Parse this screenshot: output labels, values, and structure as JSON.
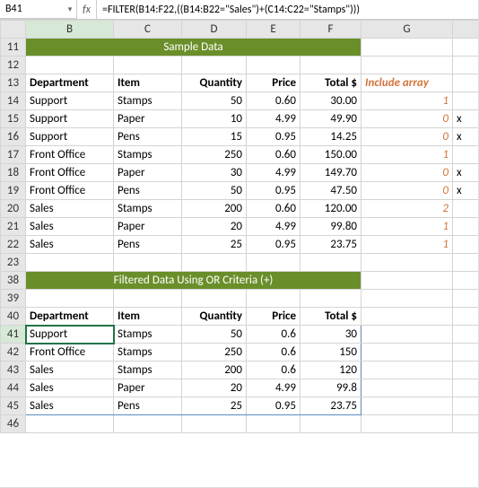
{
  "name_box": "B41",
  "formula": "=FILTER(B14:F22,((B14:B22=\"Sales\")+(C14:C22=\"Stamps\")))",
  "columns": [
    "B",
    "C",
    "D",
    "E",
    "F",
    "G"
  ],
  "row_groups": [
    [
      11,
      12,
      13,
      14,
      15,
      16,
      17,
      18,
      19,
      20,
      21,
      22,
      23
    ],
    [
      38,
      39,
      40,
      41,
      42,
      43,
      44,
      45,
      46
    ]
  ],
  "title_sample": "Sample Data",
  "title_filtered": "Filtered Data Using OR Criteria (+)",
  "headers": {
    "dept": "Department",
    "item": "Item",
    "qty": "Quantity",
    "price": "Price",
    "total": "Total $",
    "include": "Include array"
  },
  "sample": [
    {
      "dept": "Support",
      "item": "Stamps",
      "qty": "50",
      "price": "0.60",
      "total": "30.00",
      "inc": "1",
      "x": ""
    },
    {
      "dept": "Support",
      "item": "Paper",
      "qty": "10",
      "price": "4.99",
      "total": "49.90",
      "inc": "0",
      "x": "x"
    },
    {
      "dept": "Support",
      "item": "Pens",
      "qty": "15",
      "price": "0.95",
      "total": "14.25",
      "inc": "0",
      "x": "x"
    },
    {
      "dept": "Front Office",
      "item": "Stamps",
      "qty": "250",
      "price": "0.60",
      "total": "150.00",
      "inc": "1",
      "x": ""
    },
    {
      "dept": "Front Office",
      "item": "Paper",
      "qty": "30",
      "price": "4.99",
      "total": "149.70",
      "inc": "0",
      "x": "x"
    },
    {
      "dept": "Front Office",
      "item": "Pens",
      "qty": "50",
      "price": "0.95",
      "total": "47.50",
      "inc": "0",
      "x": "x"
    },
    {
      "dept": "Sales",
      "item": "Stamps",
      "qty": "200",
      "price": "0.60",
      "total": "120.00",
      "inc": "2",
      "x": ""
    },
    {
      "dept": "Sales",
      "item": "Paper",
      "qty": "20",
      "price": "4.99",
      "total": "99.80",
      "inc": "1",
      "x": ""
    },
    {
      "dept": "Sales",
      "item": "Pens",
      "qty": "25",
      "price": "0.95",
      "total": "23.75",
      "inc": "1",
      "x": ""
    }
  ],
  "filtered": [
    {
      "dept": "Support",
      "item": "Stamps",
      "qty": "50",
      "price": "0.6",
      "total": "30"
    },
    {
      "dept": "Front Office",
      "item": "Stamps",
      "qty": "250",
      "price": "0.6",
      "total": "150"
    },
    {
      "dept": "Sales",
      "item": "Stamps",
      "qty": "200",
      "price": "0.6",
      "total": "120"
    },
    {
      "dept": "Sales",
      "item": "Paper",
      "qty": "20",
      "price": "4.99",
      "total": "99.8"
    },
    {
      "dept": "Sales",
      "item": "Pens",
      "qty": "25",
      "price": "0.95",
      "total": "23.75"
    }
  ],
  "chart_data": {
    "type": "table",
    "title": "Sample Data",
    "columns": [
      "Department",
      "Item",
      "Quantity",
      "Price",
      "Total $",
      "Include array"
    ],
    "rows": [
      [
        "Support",
        "Stamps",
        50,
        0.6,
        30.0,
        1
      ],
      [
        "Support",
        "Paper",
        10,
        4.99,
        49.9,
        0
      ],
      [
        "Support",
        "Pens",
        15,
        0.95,
        14.25,
        0
      ],
      [
        "Front Office",
        "Stamps",
        250,
        0.6,
        150.0,
        1
      ],
      [
        "Front Office",
        "Paper",
        30,
        4.99,
        149.7,
        0
      ],
      [
        "Front Office",
        "Pens",
        50,
        0.95,
        47.5,
        0
      ],
      [
        "Sales",
        "Stamps",
        200,
        0.6,
        120.0,
        2
      ],
      [
        "Sales",
        "Paper",
        20,
        4.99,
        99.8,
        1
      ],
      [
        "Sales",
        "Pens",
        25,
        0.95,
        23.75,
        1
      ]
    ]
  }
}
